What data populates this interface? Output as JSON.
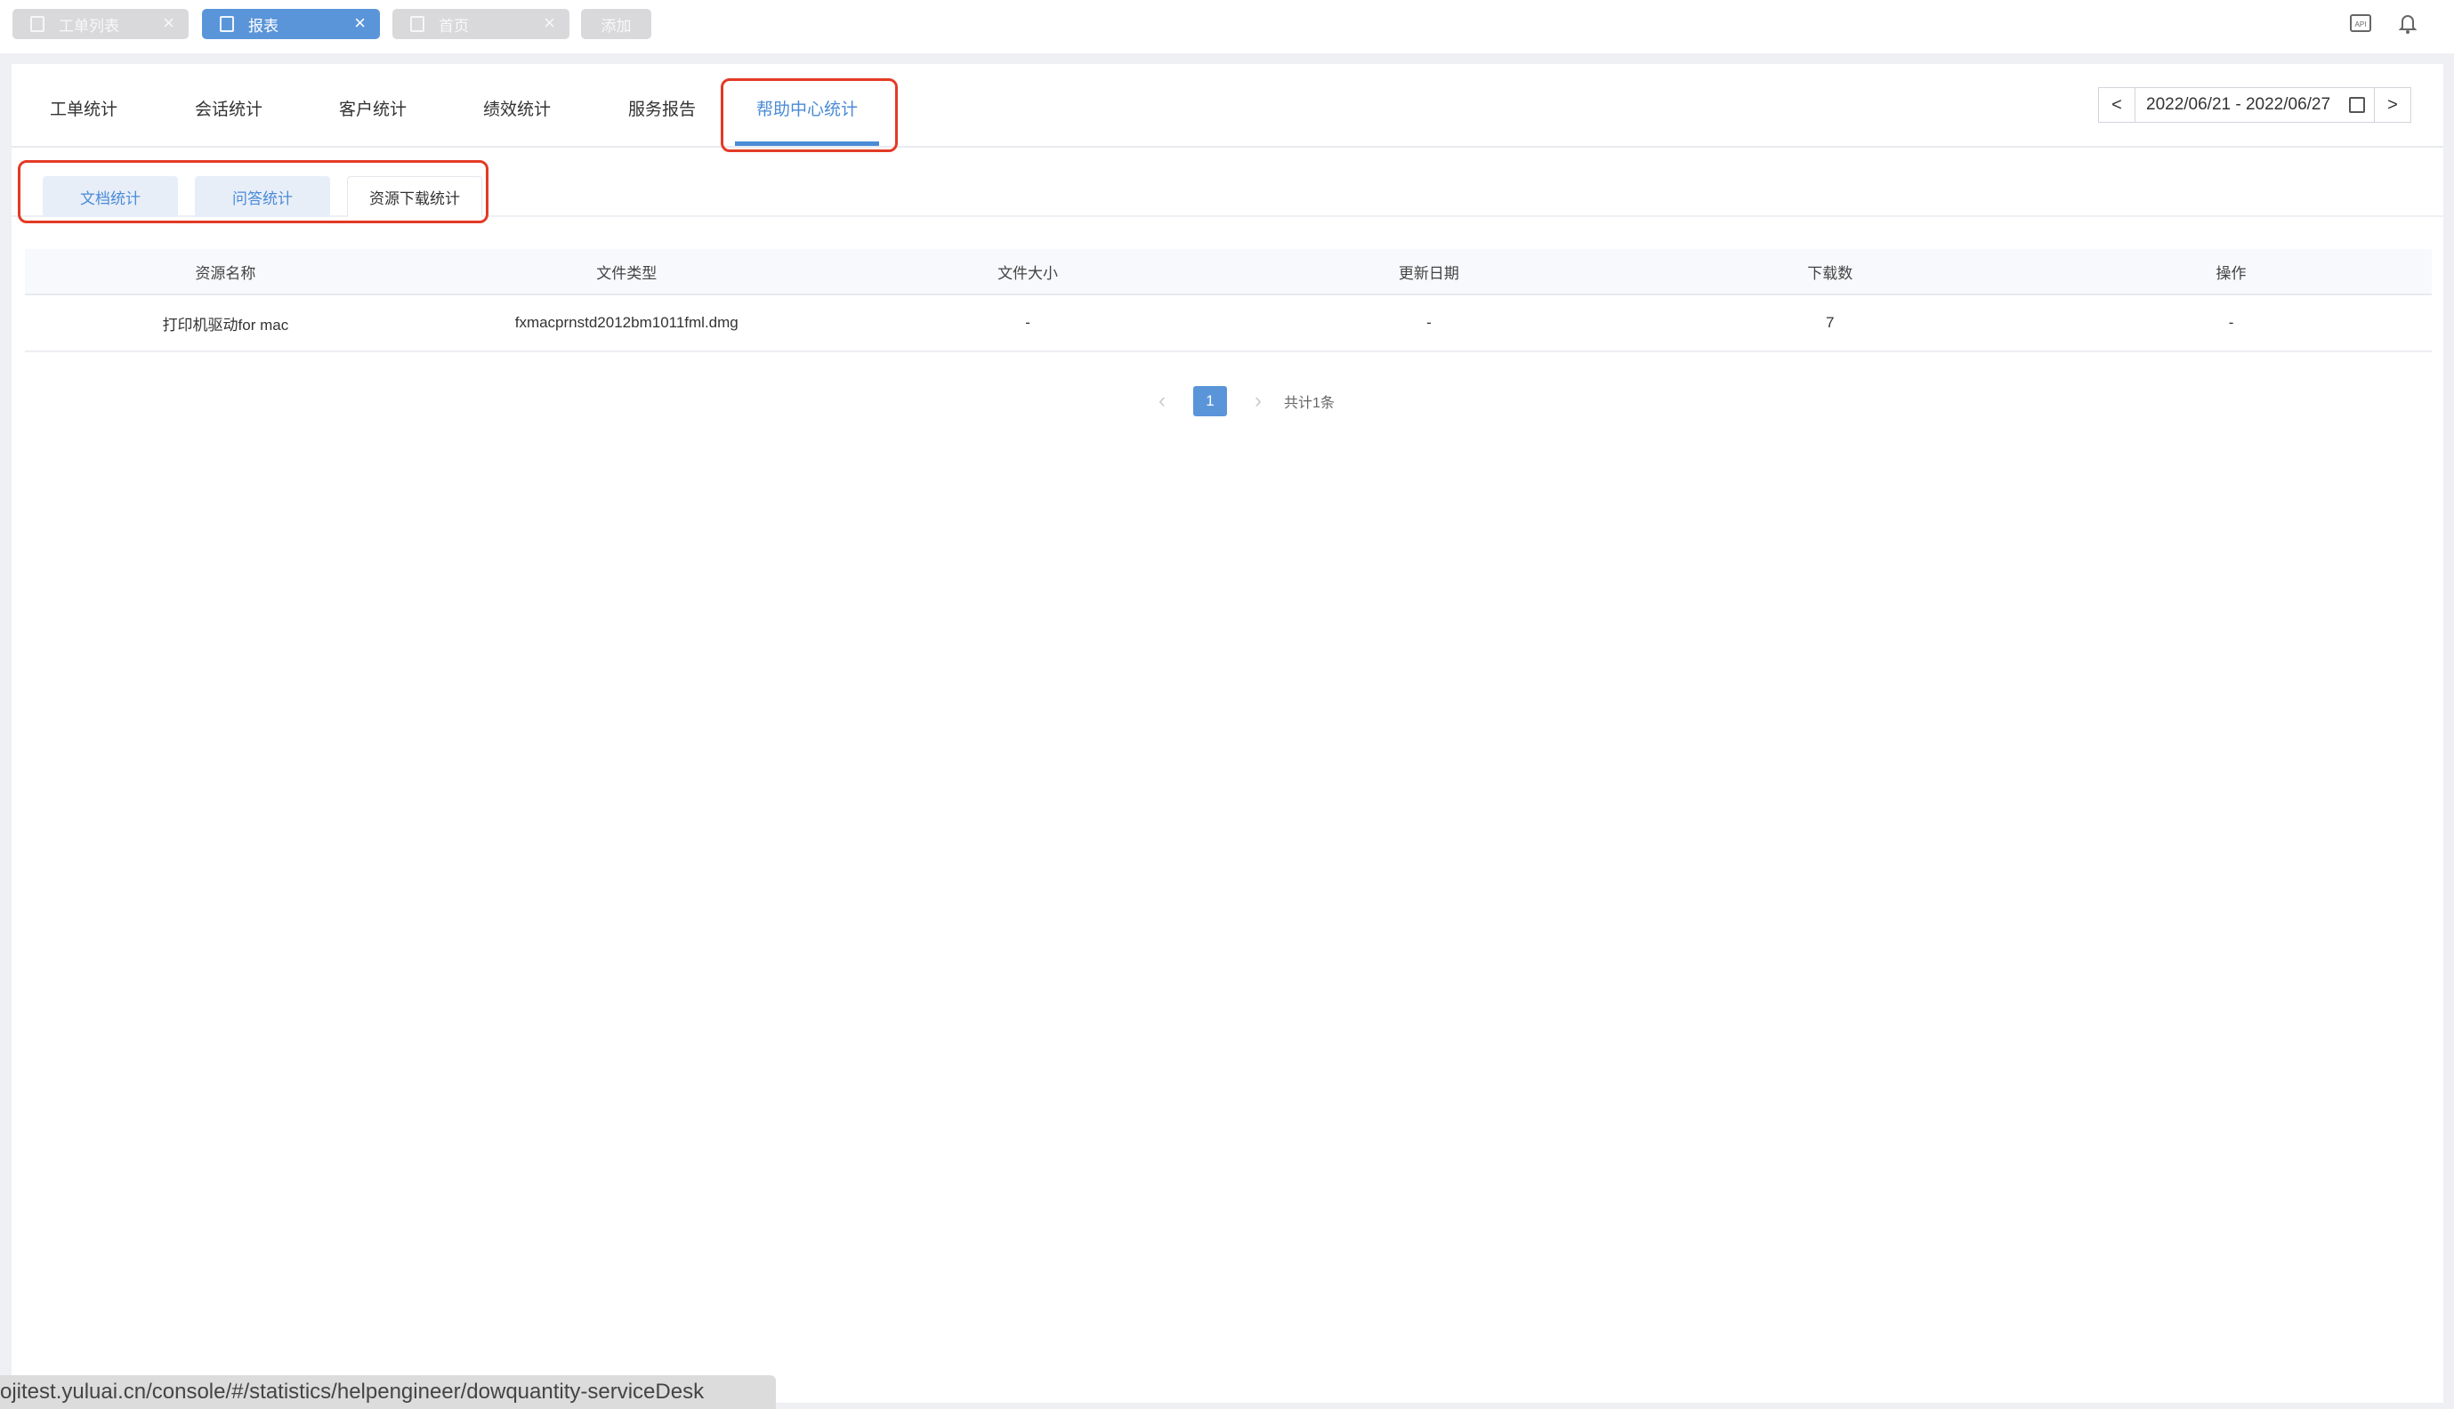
{
  "window_tabs": [
    {
      "label": "工单列表",
      "state": "inactive"
    },
    {
      "label": "报表",
      "state": "active"
    },
    {
      "label": "首页",
      "state": "inactive"
    }
  ],
  "add_tab_label": "添加",
  "top_icons": [
    "api-icon",
    "bell-icon"
  ],
  "nav": {
    "tabs": [
      "工单统计",
      "会话统计",
      "客户统计",
      "绩效统计",
      "服务报告",
      "帮助中心统计"
    ],
    "active_index": 5
  },
  "date_picker": {
    "prev": "<",
    "range": "2022/06/21 - 2022/06/27",
    "next": ">"
  },
  "sub_tabs": [
    "文档统计",
    "问答统计",
    "资源下载统计"
  ],
  "table": {
    "headers": [
      "资源名称",
      "文件类型",
      "文件大小",
      "更新日期",
      "下载数",
      "操作"
    ],
    "rows": [
      [
        "打印机驱动for mac",
        "fxmacprnstd2012bm1011fml.dmg",
        "-",
        "-",
        "7",
        "-"
      ]
    ]
  },
  "pagination": {
    "current_page": "1",
    "total_text": "共计1条"
  },
  "status_url": "ojitest.yuluai.cn/console/#/statistics/helpengineer/dowquantity-serviceDesk",
  "colors": {
    "accent": "#4a8bd6",
    "highlight": "#e33a25"
  }
}
